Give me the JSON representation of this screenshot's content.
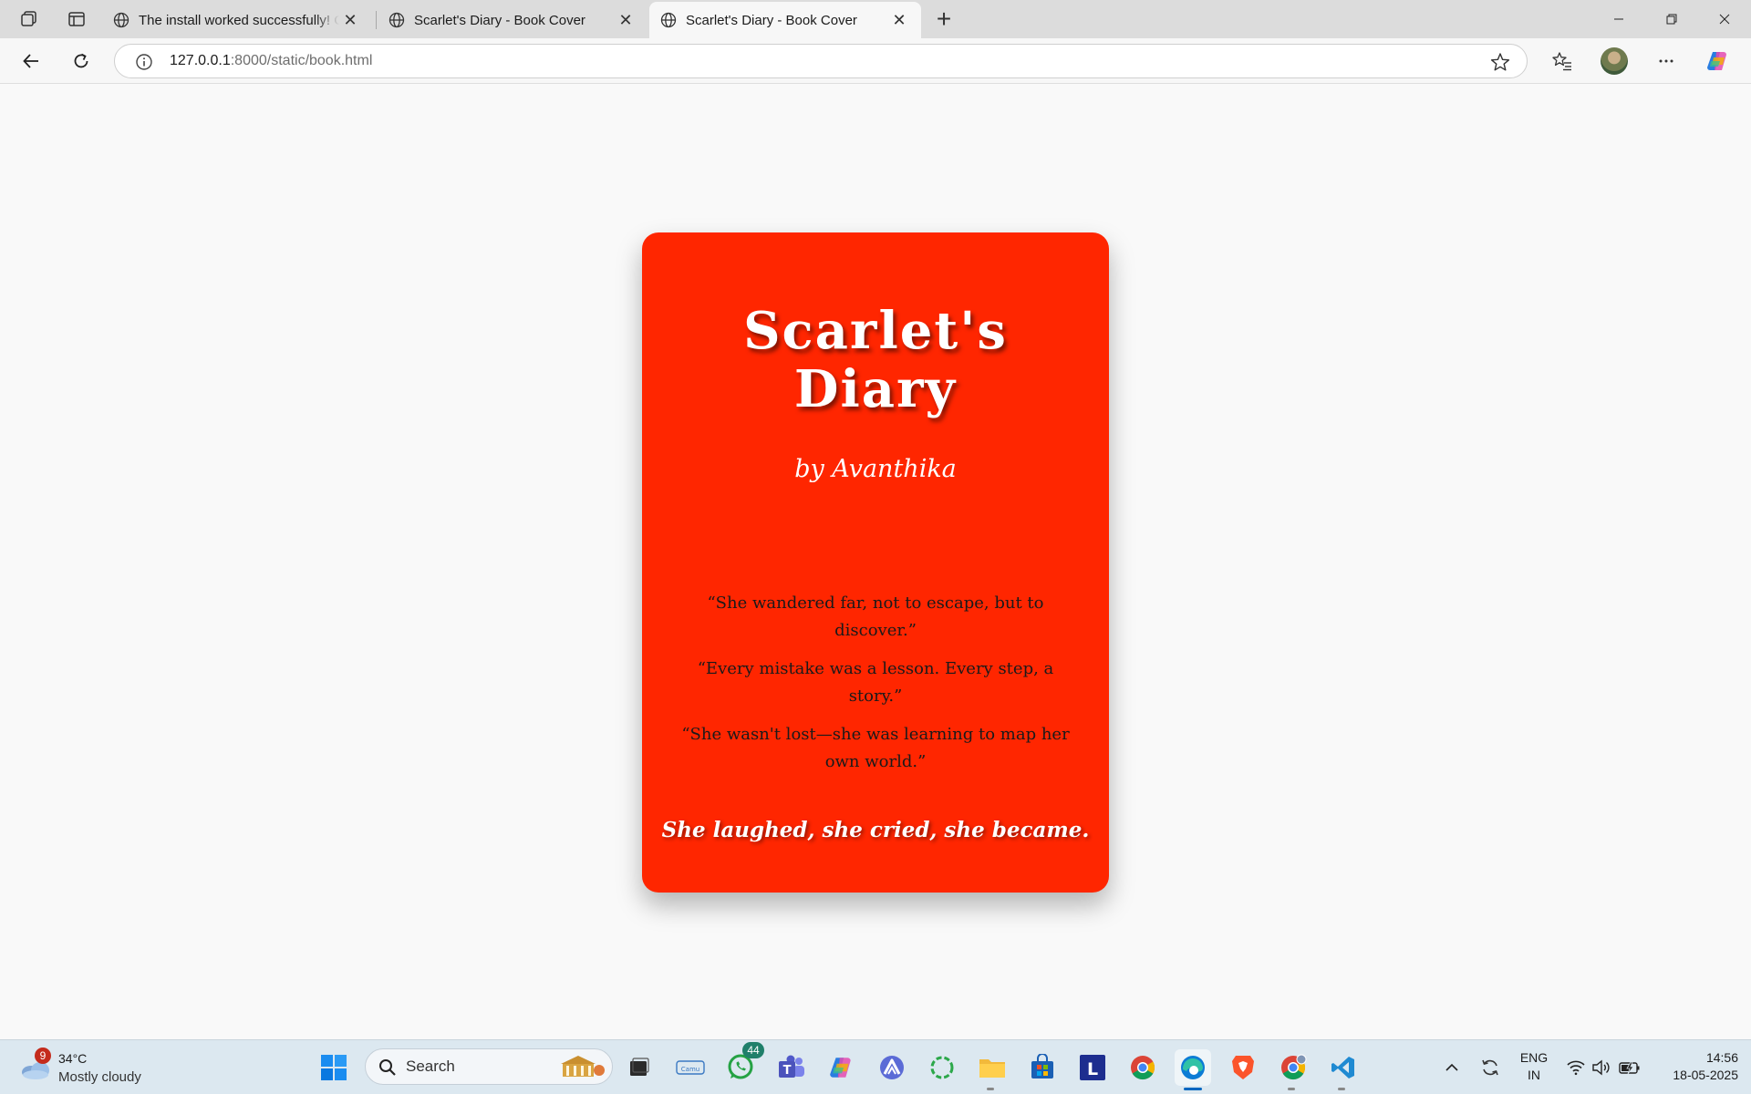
{
  "browser": {
    "tabs": [
      {
        "title": "The install worked successfully! Co",
        "active": false
      },
      {
        "title": "Scarlet's Diary - Book Cover",
        "active": false
      },
      {
        "title": "Scarlet's Diary - Book Cover",
        "active": true
      }
    ],
    "address": {
      "host": "127.0.0.1",
      "path": ":8000/static/book.html"
    }
  },
  "cover": {
    "title_line1": "Scarlet's",
    "title_line2": "Diary",
    "author": "by Avanthika",
    "quotes": [
      "“She wandered far, not to escape, but to discover.”",
      "“Every mistake was a lesson. Every step, a story.”",
      "“She wasn't lost—she was learning to map her own world.”"
    ],
    "tagline": "She laughed, she cried, she became.",
    "background_color": "#ff2600"
  },
  "taskbar": {
    "weather": {
      "badge": "9",
      "temperature": "34°C",
      "condition": "Mostly cloudy"
    },
    "search_label": "Search",
    "whatsapp_badge": "44",
    "language": {
      "line1": "ENG",
      "line2": "IN"
    },
    "clock": {
      "time": "14:56",
      "date": "18-05-2025"
    }
  }
}
